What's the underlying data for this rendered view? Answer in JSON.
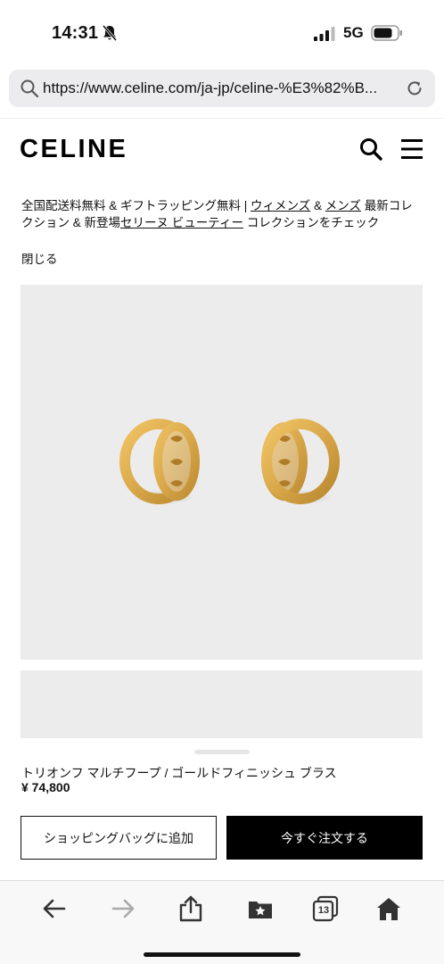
{
  "status_bar": {
    "time": "14:31",
    "network": "5G"
  },
  "browser": {
    "url": "https://www.celine.com/ja-jp/celine-%E3%82%B..."
  },
  "header": {
    "logo": "CELINE"
  },
  "announcement": {
    "part1": "全国配送料無料 & ギフトラッピング無料 | ",
    "link_women": "ウィメンズ",
    "amp": " & ",
    "link_men": "メンズ",
    "part2": " 最新コレクション & 新登場",
    "link_beauty": "セリーヌ ビューティー",
    "part3": " コレクションをチェック",
    "close": "閉じる"
  },
  "product": {
    "name": "トリオンフ マルチフープ / ゴールドフィニッシュ ブラス",
    "price": "¥ 74,800",
    "add_to_bag": "ショッピングバッグに追加",
    "buy_now": "今すぐ注文する"
  },
  "toolbar": {
    "tabs_count": "13"
  },
  "colors": {
    "gold": "#d9a84a",
    "image_bg": "#ececec",
    "black": "#000000"
  }
}
